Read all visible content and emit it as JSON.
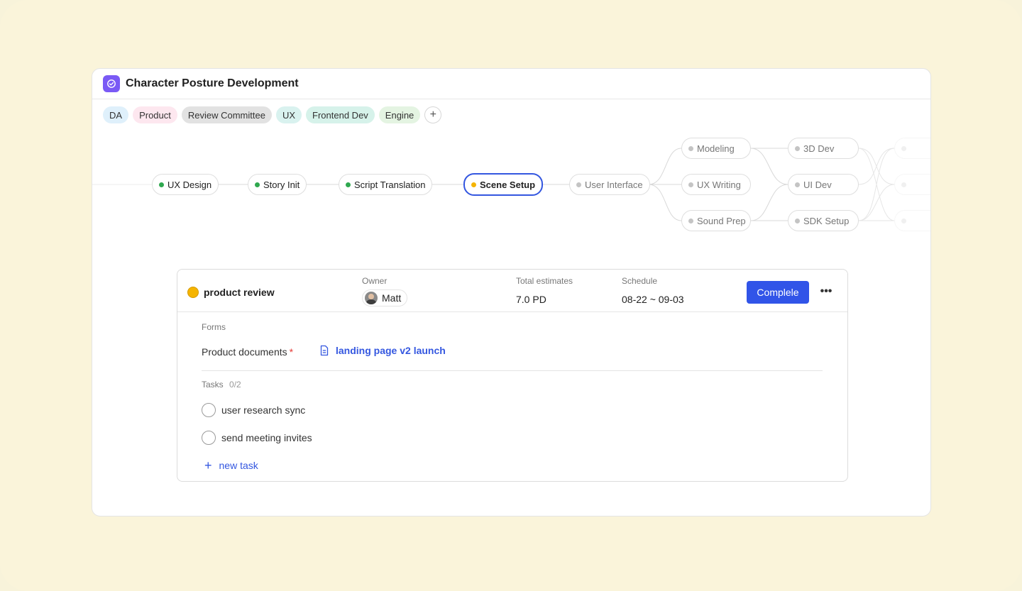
{
  "project": {
    "title": "Character Posture Development"
  },
  "tags": [
    {
      "label": "DA",
      "bg": "#dff0fb"
    },
    {
      "label": "Product",
      "bg": "#fde7ef"
    },
    {
      "label": "Review Committee",
      "bg": "#e2e2e2"
    },
    {
      "label": "UX",
      "bg": "#d9f2ef"
    },
    {
      "label": "Frontend Dev",
      "bg": "#d6f2ea"
    },
    {
      "label": "Engine",
      "bg": "#e4f4e2"
    }
  ],
  "flow": {
    "nodes": [
      {
        "label": "UX Design",
        "state": "done"
      },
      {
        "label": "Story Init",
        "state": "done"
      },
      {
        "label": "Script Translation",
        "state": "done"
      },
      {
        "label": "Scene Setup",
        "state": "active"
      },
      {
        "label": "User Interface",
        "state": "future"
      },
      {
        "label": "Modeling",
        "state": "future"
      },
      {
        "label": "UX Writing",
        "state": "future"
      },
      {
        "label": "Sound Prep",
        "state": "future"
      },
      {
        "label": "3D Dev",
        "state": "future"
      },
      {
        "label": "UI Dev",
        "state": "future"
      },
      {
        "label": "SDK Setup",
        "state": "future"
      }
    ],
    "colors": {
      "done": "#2fa84f",
      "active": "#f5b400",
      "future": "#c4c4c4",
      "active_border": "#3457e0"
    }
  },
  "detail": {
    "stage_name": "product review",
    "owner_label": "Owner",
    "owner_name": "Matt",
    "estimates_label": "Total estimates",
    "estimates_value": "7.0 PD",
    "schedule_label": "Schedule",
    "schedule_value": "08-22 ~ 09-03",
    "complete_label": "Complele",
    "more_label": "•••",
    "forms_label": "Forms",
    "doc_label": "Product documents",
    "doc_required": "*",
    "doc_link": "landing page v2 launch",
    "tasks_label": "Tasks",
    "tasks_count": "0/2",
    "tasks": [
      "user research sync",
      "send meeting invites"
    ],
    "new_task_label": "new task"
  }
}
